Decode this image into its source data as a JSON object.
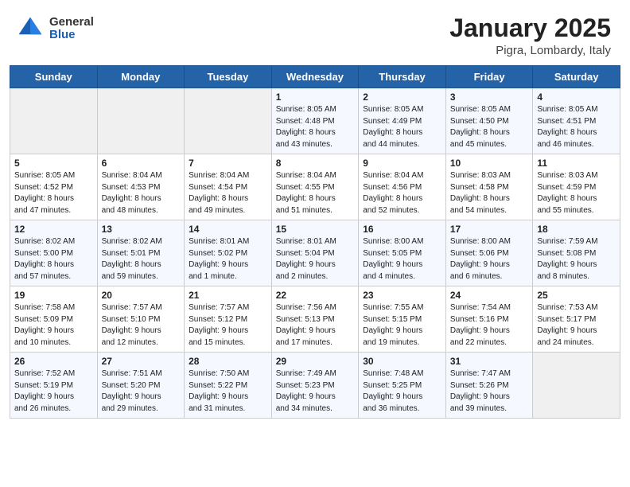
{
  "header": {
    "logo_general": "General",
    "logo_blue": "Blue",
    "title": "January 2025",
    "location": "Pigra, Lombardy, Italy"
  },
  "weekdays": [
    "Sunday",
    "Monday",
    "Tuesday",
    "Wednesday",
    "Thursday",
    "Friday",
    "Saturday"
  ],
  "weeks": [
    [
      {
        "day": "",
        "info": ""
      },
      {
        "day": "",
        "info": ""
      },
      {
        "day": "",
        "info": ""
      },
      {
        "day": "1",
        "info": "Sunrise: 8:05 AM\nSunset: 4:48 PM\nDaylight: 8 hours\nand 43 minutes."
      },
      {
        "day": "2",
        "info": "Sunrise: 8:05 AM\nSunset: 4:49 PM\nDaylight: 8 hours\nand 44 minutes."
      },
      {
        "day": "3",
        "info": "Sunrise: 8:05 AM\nSunset: 4:50 PM\nDaylight: 8 hours\nand 45 minutes."
      },
      {
        "day": "4",
        "info": "Sunrise: 8:05 AM\nSunset: 4:51 PM\nDaylight: 8 hours\nand 46 minutes."
      }
    ],
    [
      {
        "day": "5",
        "info": "Sunrise: 8:05 AM\nSunset: 4:52 PM\nDaylight: 8 hours\nand 47 minutes."
      },
      {
        "day": "6",
        "info": "Sunrise: 8:04 AM\nSunset: 4:53 PM\nDaylight: 8 hours\nand 48 minutes."
      },
      {
        "day": "7",
        "info": "Sunrise: 8:04 AM\nSunset: 4:54 PM\nDaylight: 8 hours\nand 49 minutes."
      },
      {
        "day": "8",
        "info": "Sunrise: 8:04 AM\nSunset: 4:55 PM\nDaylight: 8 hours\nand 51 minutes."
      },
      {
        "day": "9",
        "info": "Sunrise: 8:04 AM\nSunset: 4:56 PM\nDaylight: 8 hours\nand 52 minutes."
      },
      {
        "day": "10",
        "info": "Sunrise: 8:03 AM\nSunset: 4:58 PM\nDaylight: 8 hours\nand 54 minutes."
      },
      {
        "day": "11",
        "info": "Sunrise: 8:03 AM\nSunset: 4:59 PM\nDaylight: 8 hours\nand 55 minutes."
      }
    ],
    [
      {
        "day": "12",
        "info": "Sunrise: 8:02 AM\nSunset: 5:00 PM\nDaylight: 8 hours\nand 57 minutes."
      },
      {
        "day": "13",
        "info": "Sunrise: 8:02 AM\nSunset: 5:01 PM\nDaylight: 8 hours\nand 59 minutes."
      },
      {
        "day": "14",
        "info": "Sunrise: 8:01 AM\nSunset: 5:02 PM\nDaylight: 9 hours\nand 1 minute."
      },
      {
        "day": "15",
        "info": "Sunrise: 8:01 AM\nSunset: 5:04 PM\nDaylight: 9 hours\nand 2 minutes."
      },
      {
        "day": "16",
        "info": "Sunrise: 8:00 AM\nSunset: 5:05 PM\nDaylight: 9 hours\nand 4 minutes."
      },
      {
        "day": "17",
        "info": "Sunrise: 8:00 AM\nSunset: 5:06 PM\nDaylight: 9 hours\nand 6 minutes."
      },
      {
        "day": "18",
        "info": "Sunrise: 7:59 AM\nSunset: 5:08 PM\nDaylight: 9 hours\nand 8 minutes."
      }
    ],
    [
      {
        "day": "19",
        "info": "Sunrise: 7:58 AM\nSunset: 5:09 PM\nDaylight: 9 hours\nand 10 minutes."
      },
      {
        "day": "20",
        "info": "Sunrise: 7:57 AM\nSunset: 5:10 PM\nDaylight: 9 hours\nand 12 minutes."
      },
      {
        "day": "21",
        "info": "Sunrise: 7:57 AM\nSunset: 5:12 PM\nDaylight: 9 hours\nand 15 minutes."
      },
      {
        "day": "22",
        "info": "Sunrise: 7:56 AM\nSunset: 5:13 PM\nDaylight: 9 hours\nand 17 minutes."
      },
      {
        "day": "23",
        "info": "Sunrise: 7:55 AM\nSunset: 5:15 PM\nDaylight: 9 hours\nand 19 minutes."
      },
      {
        "day": "24",
        "info": "Sunrise: 7:54 AM\nSunset: 5:16 PM\nDaylight: 9 hours\nand 22 minutes."
      },
      {
        "day": "25",
        "info": "Sunrise: 7:53 AM\nSunset: 5:17 PM\nDaylight: 9 hours\nand 24 minutes."
      }
    ],
    [
      {
        "day": "26",
        "info": "Sunrise: 7:52 AM\nSunset: 5:19 PM\nDaylight: 9 hours\nand 26 minutes."
      },
      {
        "day": "27",
        "info": "Sunrise: 7:51 AM\nSunset: 5:20 PM\nDaylight: 9 hours\nand 29 minutes."
      },
      {
        "day": "28",
        "info": "Sunrise: 7:50 AM\nSunset: 5:22 PM\nDaylight: 9 hours\nand 31 minutes."
      },
      {
        "day": "29",
        "info": "Sunrise: 7:49 AM\nSunset: 5:23 PM\nDaylight: 9 hours\nand 34 minutes."
      },
      {
        "day": "30",
        "info": "Sunrise: 7:48 AM\nSunset: 5:25 PM\nDaylight: 9 hours\nand 36 minutes."
      },
      {
        "day": "31",
        "info": "Sunrise: 7:47 AM\nSunset: 5:26 PM\nDaylight: 9 hours\nand 39 minutes."
      },
      {
        "day": "",
        "info": ""
      }
    ]
  ]
}
